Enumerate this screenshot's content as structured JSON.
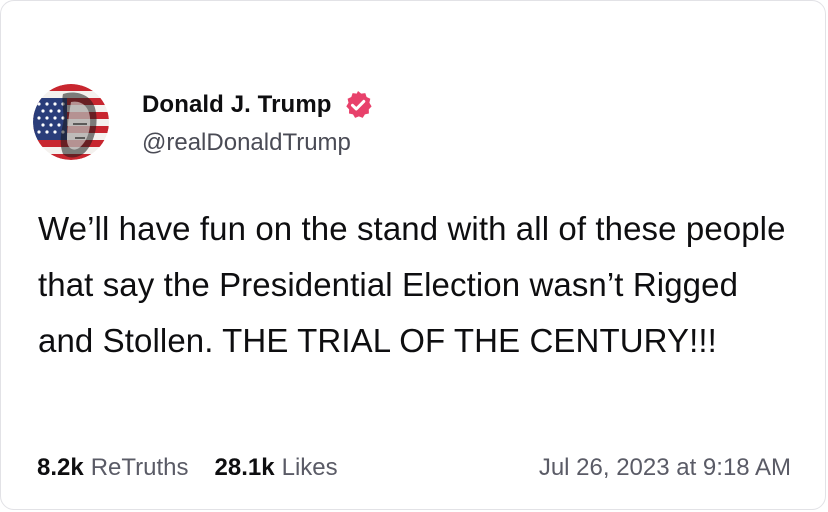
{
  "post": {
    "author": {
      "display_name": "Donald J. Trump",
      "handle": "@realDonaldTrump",
      "avatar": "flag-portrait-avatar",
      "verified_icon": "verified-badge-icon"
    },
    "text": "We’ll have fun on the stand with all of these people that say the Presidential Election wasn’t Rigged and Stollen. THE TRIAL OF THE CENTURY!!!",
    "stats": {
      "retruths_count": "8.2k",
      "retruths_label": "ReTruths",
      "likes_count": "28.1k",
      "likes_label": "Likes"
    },
    "timestamp": "Jul 26, 2023 at 9:18 AM"
  },
  "colors": {
    "verified_badge": "#e8416b",
    "secondary_text": "#5a5b66",
    "border": "#e2e2e6"
  }
}
